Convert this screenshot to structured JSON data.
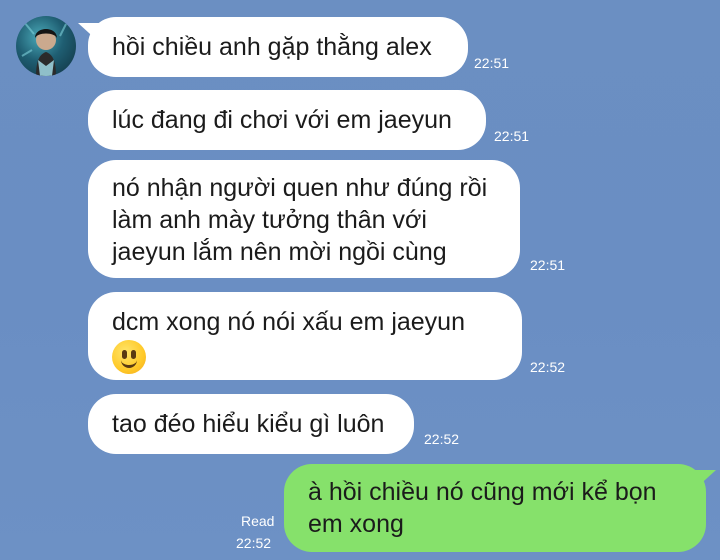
{
  "contact": {
    "avatar_icon": "contact-avatar-icon"
  },
  "messages": [
    {
      "sender": "them",
      "text": "hồi chiều anh gặp thằng alex",
      "time": "22:51"
    },
    {
      "sender": "them",
      "text": "lúc đang đi chơi với em jaeyun",
      "time": "22:51"
    },
    {
      "sender": "them",
      "lines": [
        "nó nhận người quen như đúng rồi",
        "làm anh mày tưởng thân với",
        "jaeyun lắm nên mời ngồi cùng"
      ],
      "time": "22:51"
    },
    {
      "sender": "them",
      "lines": [
        "dcm xong nó nói xấu em jaeyun"
      ],
      "emoji": "slightly-smiling-face",
      "time": "22:52"
    },
    {
      "sender": "them",
      "text": "tao đéo hiểu kiểu gì luôn",
      "time": "22:52"
    },
    {
      "sender": "me",
      "lines": [
        "à hồi chiều nó cũng mới kể bọn",
        "em xong"
      ],
      "status": "Read",
      "time": "22:52"
    }
  ],
  "colors": {
    "background": "#6b8fc2",
    "incoming_bubble": "#ffffff",
    "outgoing_bubble": "#86e16b",
    "timestamp": "#ffffff"
  }
}
